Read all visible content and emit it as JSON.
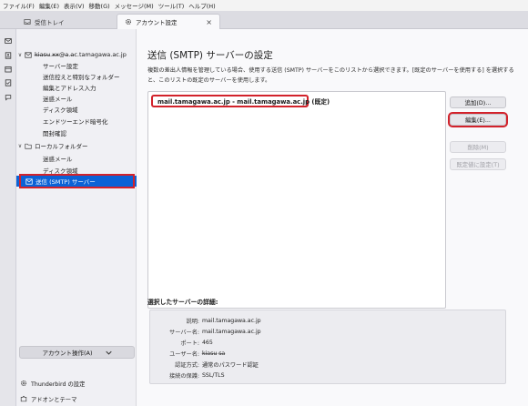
{
  "menubar": [
    "ファイル(F)",
    "編集(E)",
    "表示(V)",
    "移動(G)",
    "メッセージ(M)",
    "ツール(T)",
    "ヘルプ(H)"
  ],
  "tabs": [
    {
      "label": "受信トレイ"
    },
    {
      "label": "アカウント設定",
      "close": "×"
    }
  ],
  "sidebar": {
    "items": [
      {
        "label": "k̶i̶a̶s̶u̶.x̶x̶@a̶.a̶c.tamagawa.ac.jp",
        "twisty": "∨"
      },
      {
        "label": "サーバー設定"
      },
      {
        "label": "送信控えと特別なフォルダー"
      },
      {
        "label": "編集とアドレス入力"
      },
      {
        "label": "迷惑メール"
      },
      {
        "label": "ディスク領域"
      },
      {
        "label": "エンドツーエンド暗号化"
      },
      {
        "label": "開封確認"
      },
      {
        "label": "ローカルフォルダー",
        "twisty": "∨"
      },
      {
        "label": "迷惑メール"
      },
      {
        "label": "ディスク領域"
      },
      {
        "label": "送信 (SMTP) サーバー"
      }
    ],
    "account_actions": "アカウント操作(A)",
    "footer": [
      {
        "label": "Thunderbird の設定"
      },
      {
        "label": "アドオンとテーマ"
      }
    ]
  },
  "main": {
    "title": "送信 (SMTP) サーバーの設定",
    "description": "複数の差出人情報を管理している場合、使用する送信 (SMTP) サーバーをこのリストから選択できます。[既定のサーバーを使用する] を選択すると、このリストの既定のサーバーを使用します。",
    "servers": [
      "mail.tamagawa.ac.jp - mail.tamagawa.ac.jp (既定)"
    ],
    "buttons": {
      "add": "追加(D)...",
      "edit": "編集(E)...",
      "remove": "削除(M)",
      "set_default": "既定値に設定(T)"
    },
    "details_title": "選択したサーバーの詳細:",
    "details": [
      {
        "label": "説明:",
        "value": "mail.tamagawa.ac.jp"
      },
      {
        "label": "サーバー名:",
        "value": "mail.tamagawa.ac.jp"
      },
      {
        "label": "ポート:",
        "value": "465"
      },
      {
        "label": "ユーザー名:",
        "value": "k̶i̶a̶s̶u̶ s̶a̶"
      },
      {
        "label": "認証方式:",
        "value": "通常のパスワード認証"
      },
      {
        "label": "接続の保護:",
        "value": "SSL/TLS"
      }
    ]
  },
  "colors": {
    "selection": "#0b62d6",
    "highlight_border": "#d2222b"
  }
}
